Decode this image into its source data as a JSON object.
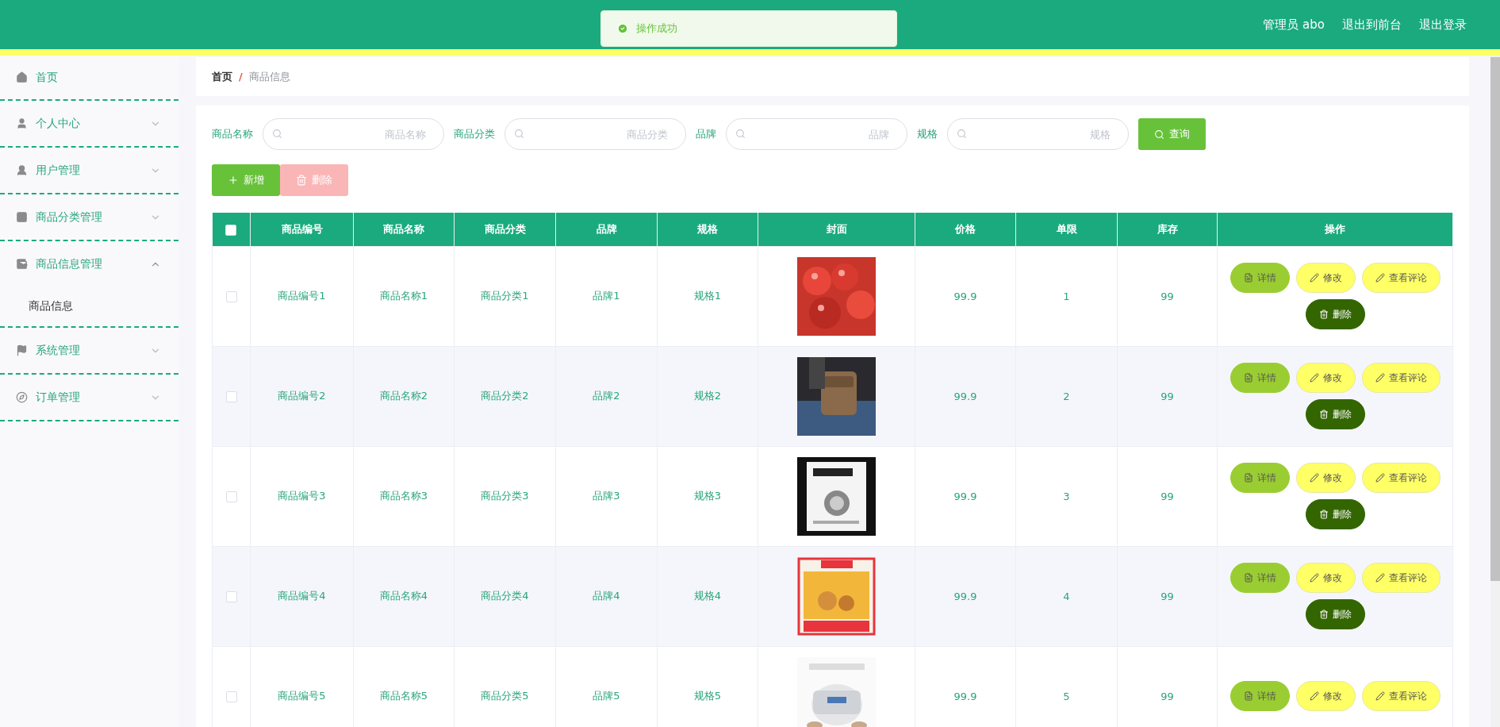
{
  "header": {
    "toast": "操作成功",
    "links": [
      "管理员 abo",
      "退出到前台",
      "退出登录"
    ]
  },
  "sidebar": {
    "items": [
      {
        "label": "首页",
        "kind": "link"
      },
      {
        "label": "个人中心",
        "kind": "group",
        "expanded": false
      },
      {
        "label": "用户管理",
        "kind": "group",
        "expanded": false
      },
      {
        "label": "商品分类管理",
        "kind": "group",
        "expanded": false
      },
      {
        "label": "商品信息管理",
        "kind": "group",
        "expanded": true,
        "children": [
          {
            "label": "商品信息"
          }
        ]
      },
      {
        "label": "系统管理",
        "kind": "group",
        "expanded": false
      },
      {
        "label": "订单管理",
        "kind": "group",
        "expanded": false
      }
    ]
  },
  "breadcrumb": {
    "items": [
      "首页",
      "商品信息"
    ],
    "separator": "/"
  },
  "search": {
    "fields": [
      {
        "label": "商品名称",
        "placeholder": "商品名称"
      },
      {
        "label": "商品分类",
        "placeholder": "商品分类"
      },
      {
        "label": "品牌",
        "placeholder": "品牌"
      },
      {
        "label": "规格",
        "placeholder": "规格"
      }
    ],
    "button": "查询"
  },
  "toolbar": [
    {
      "label": "新增",
      "kind": "add",
      "disabled": false
    },
    {
      "label": "删除",
      "kind": "delete",
      "disabled": true
    }
  ],
  "table": {
    "select_all": {
      "checked": false
    },
    "columns": [
      "商品编号",
      "商品名称",
      "商品分类",
      "品牌",
      "规格",
      "封面",
      "价格",
      "单限",
      "库存",
      "操作"
    ],
    "rows": [
      {
        "checked": false,
        "cells": [
          "商品编号1",
          "商品名称1",
          "商品分类1",
          "品牌1",
          "规格1"
        ],
        "cover": {
          "kind": "picture"
        },
        "tail": [
          "99.9",
          "1",
          "99"
        ],
        "actions": [
          {
            "label": "详情",
            "kind": "detail"
          },
          {
            "label": "修改",
            "kind": "edit"
          },
          {
            "label": "查看评论",
            "kind": "edit"
          },
          {
            "label": "删除",
            "kind": "delete"
          }
        ]
      },
      {
        "checked": false,
        "cells": [
          "商品编号2",
          "商品名称2",
          "商品分类2",
          "品牌2",
          "规格2"
        ],
        "cover": {
          "kind": "picture"
        },
        "tail": [
          "99.9",
          "2",
          "99"
        ],
        "actions": [
          {
            "label": "详情",
            "kind": "detail"
          },
          {
            "label": "修改",
            "kind": "edit"
          },
          {
            "label": "查看评论",
            "kind": "edit"
          },
          {
            "label": "删除",
            "kind": "delete"
          }
        ]
      },
      {
        "checked": false,
        "cells": [
          "商品编号3",
          "商品名称3",
          "商品分类3",
          "品牌3",
          "规格3"
        ],
        "cover": {
          "kind": "picture"
        },
        "tail": [
          "99.9",
          "3",
          "99"
        ],
        "actions": [
          {
            "label": "详情",
            "kind": "detail"
          },
          {
            "label": "修改",
            "kind": "edit"
          },
          {
            "label": "查看评论",
            "kind": "edit"
          },
          {
            "label": "删除",
            "kind": "delete"
          }
        ]
      },
      {
        "checked": false,
        "cells": [
          "商品编号4",
          "商品名称4",
          "商品分类4",
          "品牌4",
          "规格4"
        ],
        "cover": {
          "kind": "picture"
        },
        "tail": [
          "99.9",
          "4",
          "99"
        ],
        "actions": [
          {
            "label": "详情",
            "kind": "detail"
          },
          {
            "label": "修改",
            "kind": "edit"
          },
          {
            "label": "查看评论",
            "kind": "edit"
          },
          {
            "label": "删除",
            "kind": "delete"
          }
        ]
      },
      {
        "checked": false,
        "cells": [
          "商品编号5",
          "商品名称5",
          "商品分类5",
          "品牌5",
          "规格5"
        ],
        "cover": {
          "kind": "picture"
        },
        "tail": [
          "99.9",
          "5",
          "99"
        ],
        "actions": [
          {
            "label": "详情",
            "kind": "detail"
          },
          {
            "label": "修改",
            "kind": "edit"
          },
          {
            "label": "查看评论",
            "kind": "edit"
          }
        ]
      }
    ]
  }
}
